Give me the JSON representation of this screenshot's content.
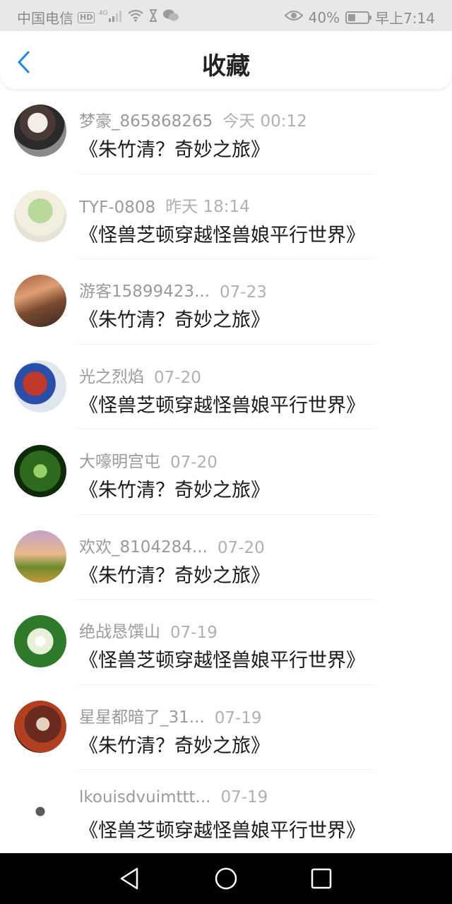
{
  "status_bar": {
    "carrier": "中国电信",
    "hd": "HD",
    "signal_type": "4G",
    "battery_percent": "40%",
    "battery_level": 0.4,
    "time": "早上7:14"
  },
  "header": {
    "title": "收藏"
  },
  "items": [
    {
      "user": "梦豪_865868265",
      "time": "今天 00:12",
      "book": "《朱竹清？奇妙之旅》"
    },
    {
      "user": "TYF-0808",
      "time": "昨天 18:14",
      "book": "《怪兽芝顿穿越怪兽娘平行世界》"
    },
    {
      "user": "游客15899423...",
      "time": "07-23",
      "book": "《朱竹清？奇妙之旅》"
    },
    {
      "user": "光之烈焰",
      "time": "07-20",
      "book": "《怪兽芝顿穿越怪兽娘平行世界》"
    },
    {
      "user": "大嚎明宫屯",
      "time": "07-20",
      "book": "《朱竹清？奇妙之旅》"
    },
    {
      "user": "欢欢_8104284...",
      "time": "07-20",
      "book": "《朱竹清？奇妙之旅》"
    },
    {
      "user": "绝战恳馔山",
      "time": "07-19",
      "book": "《怪兽芝顿穿越怪兽娘平行世界》"
    },
    {
      "user": "星星都暗了_31...",
      "time": "07-19",
      "book": "《朱竹清？奇妙之旅》"
    },
    {
      "user": "lkouisdvuimttt...",
      "time": "07-19",
      "book": "《怪兽芝顿穿越怪兽娘平行世界》"
    }
  ],
  "colors": {
    "accent": "#1e88e5",
    "text_primary": "#1a1a1a",
    "text_secondary": "#9a9a9a"
  }
}
